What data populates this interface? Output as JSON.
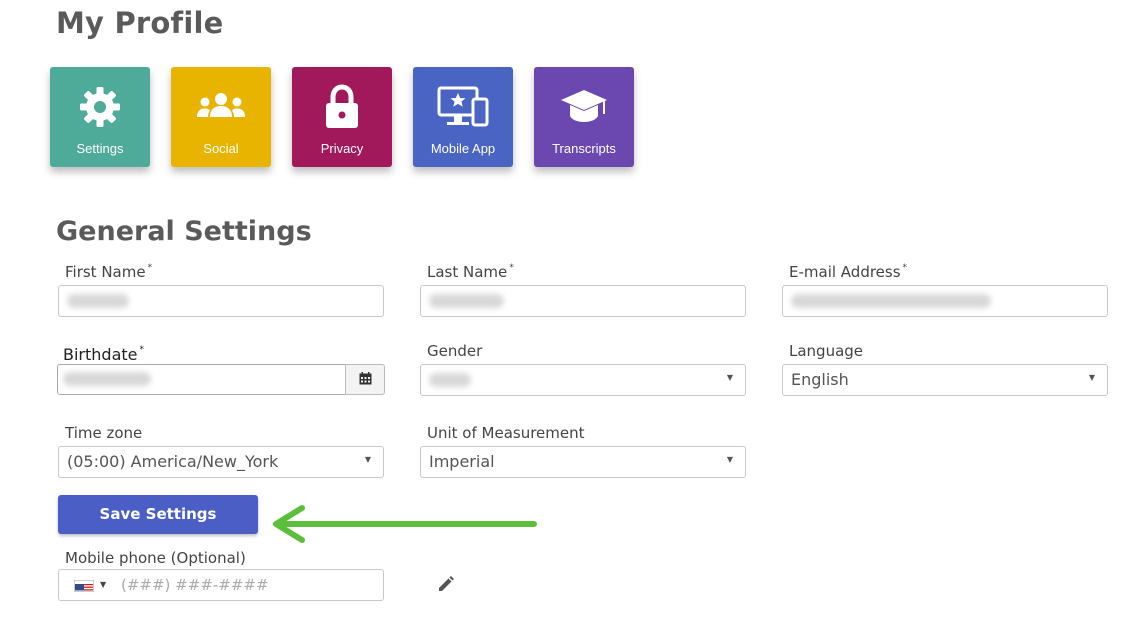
{
  "page": {
    "title": "My Profile"
  },
  "tiles": [
    {
      "label": "Settings",
      "icon": "gear-icon",
      "color": "#4fab99"
    },
    {
      "label": "Social",
      "icon": "users-icon",
      "color": "#e8b400"
    },
    {
      "label": "Privacy",
      "icon": "lock-icon",
      "color": "#a1185b"
    },
    {
      "label": "Mobile App",
      "icon": "desktop-mobile-icon",
      "color": "#4a64c4"
    },
    {
      "label": "Transcripts",
      "icon": "graduation-cap-icon",
      "color": "#6b48b0"
    }
  ],
  "general_settings": {
    "title": "General Settings",
    "first_name": {
      "label": "First Name",
      "required": "*"
    },
    "last_name": {
      "label": "Last Name",
      "required": "*"
    },
    "email": {
      "label": "E-mail Address",
      "required": "*"
    },
    "birthdate": {
      "label": "Birthdate",
      "required": "*",
      "button_icon": "calendar-icon"
    },
    "gender": {
      "label": "Gender"
    },
    "language": {
      "label": "Language",
      "value": "English"
    },
    "timezone": {
      "label": "Time zone",
      "value": "(05:00) America/New_York"
    },
    "unit": {
      "label": "Unit of Measurement",
      "value": "Imperial"
    }
  },
  "save_button": {
    "label": "Save Settings",
    "color": "#4a5ec5"
  },
  "annotation": {
    "arrow_color": "#5cbf3c"
  },
  "mobile_phone": {
    "label": "Mobile phone (Optional)",
    "placeholder": "(###) ###-####",
    "edit_icon": "pencil-icon"
  },
  "select_caret": "▼",
  "flag_caret": "▼"
}
